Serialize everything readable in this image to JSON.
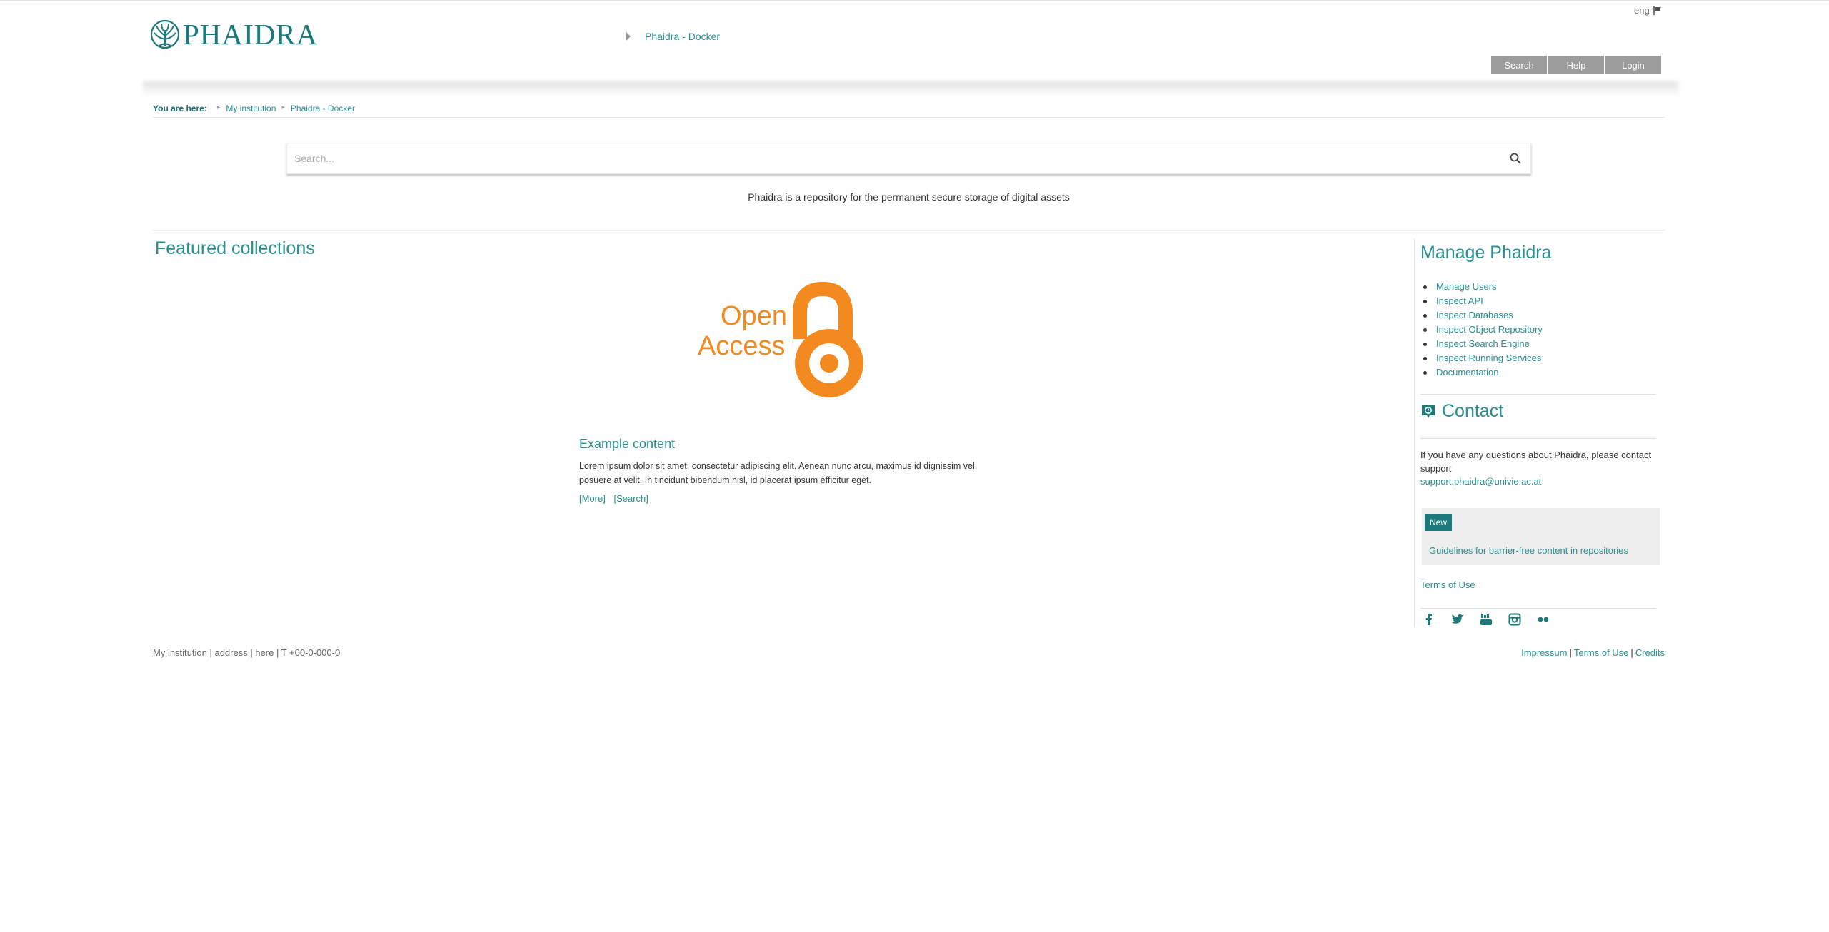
{
  "header": {
    "logo_text": "PHAIDRA",
    "site_link": "Phaidra - Docker",
    "lang": "eng",
    "buttons": {
      "search": "Search",
      "help": "Help",
      "login": "Login"
    }
  },
  "breadcrumb": {
    "label": "You are here:",
    "items": [
      "My institution",
      "Phaidra - Docker"
    ]
  },
  "search": {
    "placeholder": "Search..."
  },
  "tagline": "Phaidra is a repository for the permanent secure storage of digital assets",
  "featured": {
    "title": "Featured collections",
    "logo_line1": "Open",
    "logo_line2": "Access",
    "collection": {
      "title": "Example content",
      "description": "Lorem ipsum dolor sit amet, consectetur adipiscing elit. Aenean nunc arcu, maximus id dignissim vel, posuere at velit. In tincidunt bibendum nisl, id placerat ipsum efficitur eget.",
      "more": "[More]",
      "search": "[Search]"
    }
  },
  "sidebar": {
    "manage_title": "Manage Phaidra",
    "manage_items": [
      "Manage Users",
      "Inspect API",
      "Inspect Databases",
      "Inspect Object Repository",
      "Inspect Search Engine",
      "Inspect Running Services",
      "Documentation"
    ],
    "contact_title": "Contact",
    "contact_text": "If you have any questions about Phaidra, please contact support",
    "contact_email": "support.phaidra@univie.ac.at",
    "news_badge": "New",
    "news_link": "Guidelines for barrier-free content in repositories",
    "terms": "Terms of Use",
    "social_icons": [
      "facebook-icon",
      "twitter-icon",
      "youtube-icon",
      "instagram-icon",
      "flickr-icon"
    ]
  },
  "footer": {
    "address": "My institution | address | here | T +00-0-000-0",
    "links": [
      "Impressum",
      "Terms of Use",
      "Credits"
    ]
  },
  "colors": {
    "accent": "#2a8f8f",
    "brand_dark": "#1c7a7a",
    "oa_orange": "#f28a20",
    "button_gray": "#9c9c9c"
  }
}
